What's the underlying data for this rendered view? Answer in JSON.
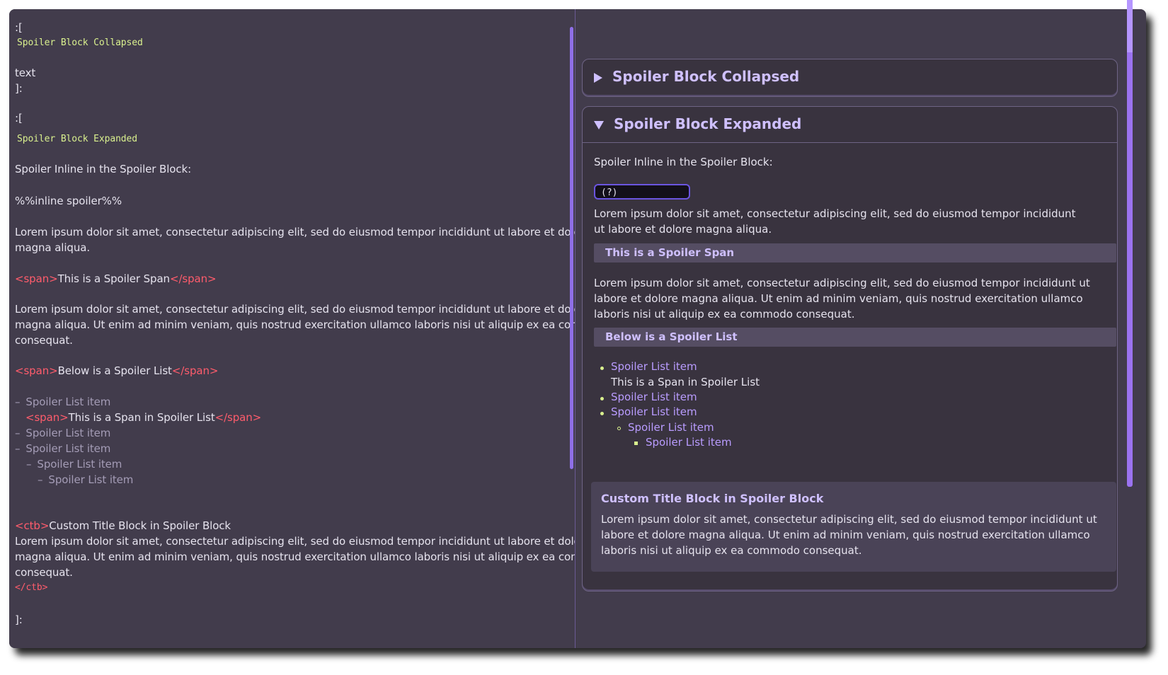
{
  "editor": {
    "lines": {
      "open1": ":[",
      "title1": "Spoiler Block Collapsed",
      "text1": "text",
      "close1": "]:",
      "open2": ":[",
      "title2": "Spoiler Block Expanded",
      "inline_label": "Spoiler Inline in the Spoiler Block:",
      "inline_src": "%%inline spoiler%%",
      "lorem1_a": "Lorem ipsum dolor sit amet, consectetur adipiscing elit, sed do eiusmod tempor incididunt ut labore et dolore",
      "lorem1_b": "magna aliqua.",
      "span1_open": "<span>",
      "span1_text": "This is a Spoiler Span",
      "span1_close": "</span>",
      "lorem2_a": "Lorem ipsum dolor sit amet, consectetur adipiscing elit, sed do eiusmod tempor incididunt ut labore et dolore",
      "lorem2_b": "magna aliqua. Ut enim ad minim veniam, quis nostrud exercitation ullamco laboris nisi ut aliquip ex ea commodo",
      "lorem2_c": "consequat.",
      "span2_open": "<span>",
      "span2_text": "Below is a Spoiler List",
      "span2_close": "</span>",
      "list_dash": "–",
      "list1": "Spoiler List item",
      "list_span_open": "<span>",
      "list_span_text": "This is a Span in Spoiler List",
      "list_span_close": "</span>",
      "list2": "Spoiler List item",
      "list3": "Spoiler List item",
      "list4": "Spoiler List item",
      "list5": "Spoiler List item",
      "ctb_open": "<ctb>",
      "ctb_title": "Custom Title Block in Spoiler Block",
      "ctb_a": "Lorem ipsum dolor sit amet, consectetur adipiscing elit, sed do eiusmod tempor incididunt ut labore et dolore",
      "ctb_b": "magna aliqua. Ut enim ad minim veniam, quis nostrud exercitation ullamco laboris nisi ut aliquip ex ea commodo",
      "ctb_c": "consequat.",
      "ctb_close": "</ctb>",
      "close2": "]:"
    }
  },
  "preview": {
    "collapsed_title": "Spoiler Block Collapsed",
    "expanded_title": "Spoiler Block Expanded",
    "inline_label": "Spoiler Inline in the Spoiler Block:",
    "inline_spoiler": "(?)",
    "lorem1": "Lorem ipsum dolor sit amet, consectetur adipiscing elit, sed do eiusmod tempor incididunt ut labore et dolore magna aliqua.",
    "span1": "This is a Spoiler Span",
    "lorem2": "Lorem ipsum dolor sit amet, consectetur adipiscing elit, sed do eiusmod tempor incididunt ut labore et dolore magna aliqua. Ut enim ad minim veniam, quis nostrud exercitation ullamco laboris nisi ut aliquip ex ea commodo consequat.",
    "span2": "Below is a Spoiler List",
    "list": {
      "item1": "Spoiler List item",
      "item1_span": "This is a Span in Spoiler List",
      "item2": "Spoiler List item",
      "item3": "Spoiler List item",
      "item4": "Spoiler List item",
      "item5": "Spoiler List item"
    },
    "ctb_title": "Custom Title Block in Spoiler Block",
    "ctb_text": "Lorem ipsum dolor sit amet, consectetur adipiscing elit, sed do eiusmod tempor incididunt ut labore et dolore magna aliqua. Ut enim ad minim veniam, quis nostrud exercitation ullamco laboris nisi ut aliquip ex ea commodo consequat."
  },
  "colors": {
    "background": "#423c4c",
    "accent": "#9b73f0",
    "tag_red": "#ff5c6c",
    "code_green": "#d9f08e",
    "title_lavender": "#cfc0ff"
  }
}
